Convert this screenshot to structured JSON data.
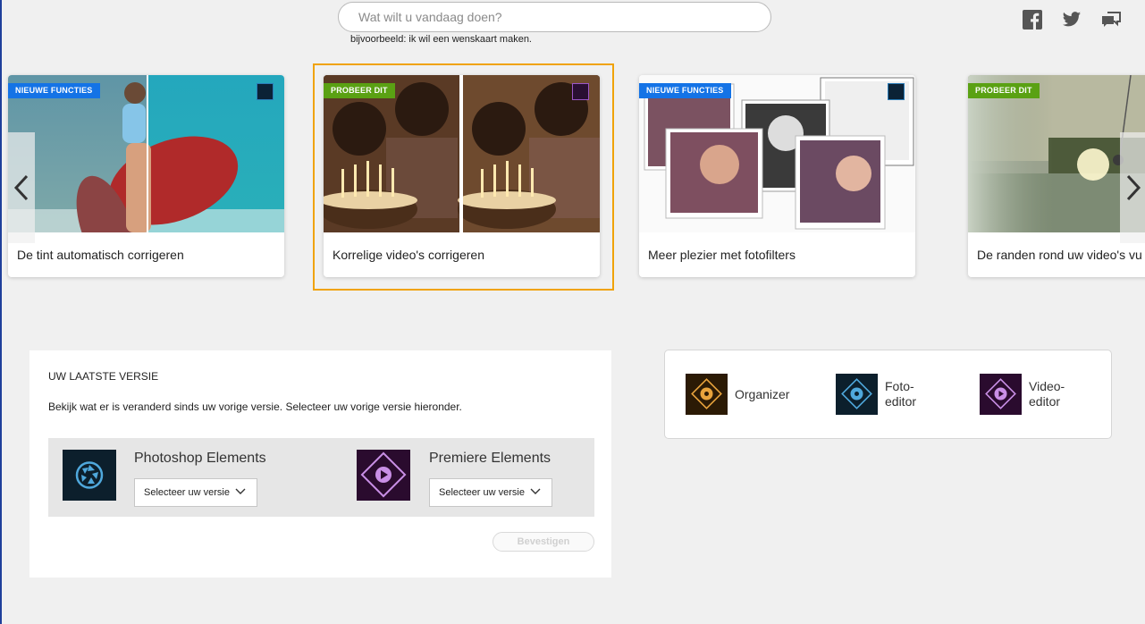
{
  "search": {
    "placeholder": "Wat wilt u vandaag doen?",
    "hint": "bijvoorbeeld: ik wil een wenskaart maken."
  },
  "social": {
    "items": [
      "facebook-icon",
      "twitter-icon",
      "feedback-icon"
    ]
  },
  "carousel": {
    "cards": [
      {
        "badge": "NIEUWE FUNCTIES",
        "badge_color": "#1473e6",
        "caption": "De tint automatisch corrigeren",
        "app": "photoshop"
      },
      {
        "badge": "PROBEER DIT",
        "badge_color": "#5aa113",
        "caption": "Korrelige video's corrigeren",
        "app": "premiere",
        "selected": true
      },
      {
        "badge": "NIEUWE FUNCTIES",
        "badge_color": "#1473e6",
        "caption": "Meer plezier met fotofilters",
        "app": "photoshop"
      },
      {
        "badge": "PROBEER DIT",
        "badge_color": "#5aa113",
        "caption": "De randen rond uw video's vu",
        "app": "premiere"
      }
    ],
    "highlight_color": "#f0a30a"
  },
  "version": {
    "title": "UW LAATSTE VERSIE",
    "description": "Bekijk wat er is veranderd sinds uw vorige versie. Selecteer uw vorige versie hieronder.",
    "products": [
      {
        "name": "Photoshop Elements",
        "select": "Selecteer uw versie"
      },
      {
        "name": "Premiere Elements",
        "select": "Selecteer uw versie"
      }
    ],
    "confirm": "Bevestigen"
  },
  "launcher": {
    "items": [
      {
        "label": "Organizer"
      },
      {
        "label_line1": "Foto-",
        "label_line2": "editor"
      },
      {
        "label_line1": "Video-",
        "label_line2": "editor"
      }
    ]
  }
}
